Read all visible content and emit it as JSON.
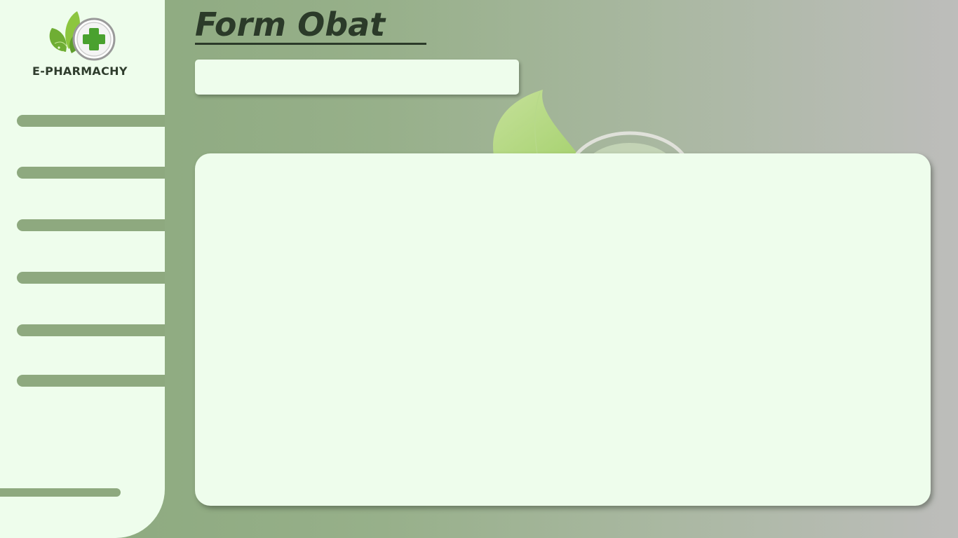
{
  "brand": {
    "name": "E-PHARMACHY",
    "icon": "leaf-cross-logo-icon",
    "colors": {
      "leaf": "#7fbf3a",
      "cross": "#4aa12f"
    }
  },
  "header": {
    "title": "Form Obat"
  },
  "search": {
    "value": "",
    "placeholder": ""
  },
  "sidebar": {
    "items": [
      {
        "label": ""
      },
      {
        "label": ""
      },
      {
        "label": ""
      },
      {
        "label": ""
      },
      {
        "label": ""
      },
      {
        "label": ""
      }
    ],
    "bottom_item": {
      "label": ""
    }
  },
  "theme": {
    "sidebar_bg": "#eefdec",
    "accent": "#8ea97f",
    "title_color": "#2b3a29",
    "panel_bg": "#eefdec"
  }
}
